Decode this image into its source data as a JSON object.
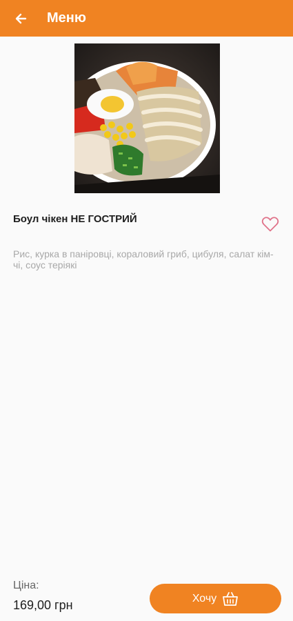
{
  "header": {
    "title": "Меню",
    "back_icon": "arrow-left-icon"
  },
  "product": {
    "image_icon": "bowl-photo",
    "name": "Боул чікен НЕ ГОСТРИЙ",
    "favorite_icon": "heart-outline-icon",
    "description": "Рис, курка в паніровці, кораловий гриб, цибуля, салат кім-чі, соус теріякі"
  },
  "footer": {
    "price_label": "Ціна:",
    "price_value": "169,00 грн",
    "want_label": "Хочу",
    "basket_icon": "basket-icon"
  },
  "colors": {
    "accent": "#f08322",
    "background": "#fafafa",
    "favorite": "#e0738a",
    "muted_text": "#a8a8a8"
  }
}
